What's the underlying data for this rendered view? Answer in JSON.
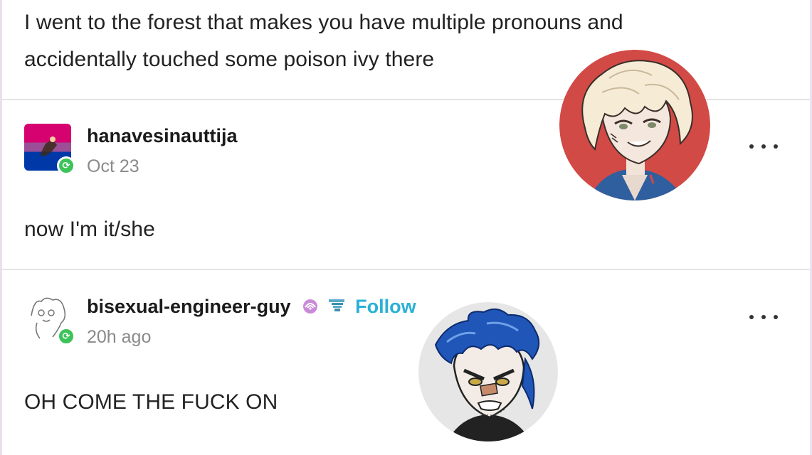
{
  "original_post": {
    "text_line1": "I went to the forest that makes you have multiple pronouns and",
    "text_line2": "accidentally touched some poison ivy there"
  },
  "reblogs": [
    {
      "username": "hanavesinauttija",
      "timestamp": "Oct 23",
      "text": "now I'm it/she",
      "more_label": "more-options"
    },
    {
      "username": "bisexual-engineer-guy",
      "follow_label": "Follow",
      "timestamp": "20h ago",
      "text": "OH COME THE FUCK ON",
      "more_label": "more-options"
    }
  ],
  "colors": {
    "reblog_badge": "#3cc35a",
    "follow": "#2ab0d6",
    "divider": "#e4e4e4",
    "avatar1_bg": "#d24a45",
    "avatar2_bg": "#e6e6e6"
  },
  "icons": {
    "reblog_badge": "reblog-icon",
    "more": "ellipsis-icon",
    "premium": "tumblr-premium-icon",
    "crab": "crab-badge-icon"
  }
}
